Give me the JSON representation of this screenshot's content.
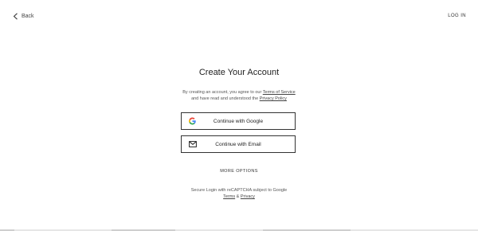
{
  "header": {
    "back_label": "Back",
    "login_label": "LOG IN"
  },
  "main": {
    "title": "Create Your Account",
    "agreement": {
      "prefix": "By creating an account, you agree to our ",
      "terms_link": "Terms of Service",
      "middle": "and have read and understood the ",
      "privacy_link": "Privacy Policy"
    },
    "google_button": {
      "label": "Continue with Google",
      "icon": "google-icon"
    },
    "email_button": {
      "label": "Continue with Email",
      "icon": "mail-icon"
    },
    "more_options": "MORE OPTIONS",
    "recaptcha": {
      "line1": "Secure Login with reCAPTCHA subject to Google",
      "terms_link": "Terms",
      "amp": " & ",
      "privacy_link": "Privacy"
    }
  },
  "colors": {
    "button_border": "#333333",
    "text": "#222222",
    "google_blue": "#4285F4",
    "google_red": "#EA4335",
    "google_yellow": "#FBBC05",
    "google_green": "#34A853"
  }
}
